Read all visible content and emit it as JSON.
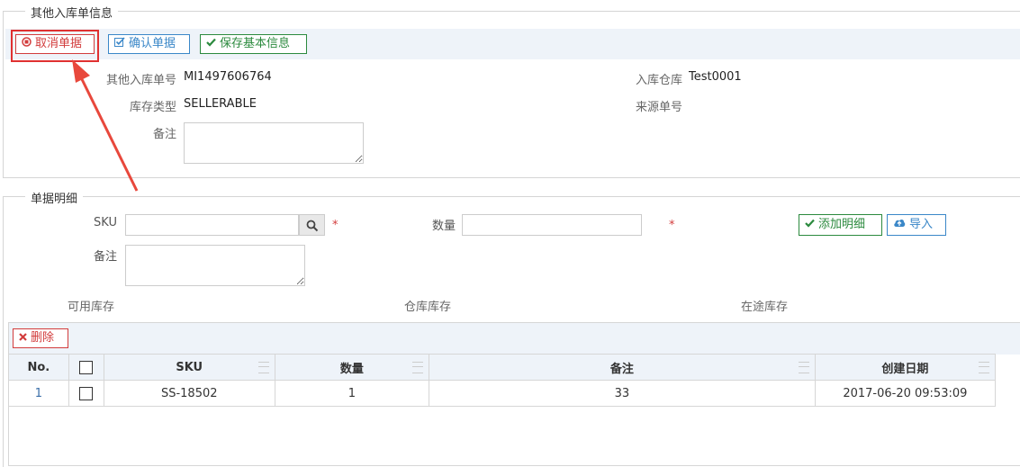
{
  "section1": {
    "title": "其他入库单信息",
    "buttons": {
      "cancel": "取消单据",
      "confirm": "确认单据",
      "save": "保存基本信息"
    },
    "fields": {
      "order_no_label": "其他入库单号",
      "order_no_value": "MI1497606764",
      "warehouse_label": "入库仓库",
      "warehouse_value": "Test0001",
      "stock_type_label": "库存类型",
      "stock_type_value": "SELLERABLE",
      "source_no_label": "来源单号",
      "remark_label": "备注"
    }
  },
  "section2": {
    "title": "单据明细",
    "sku_label": "SKU",
    "qty_label": "数量",
    "remark_label": "备注",
    "required_mark": "*",
    "add_detail_button": "添加明细",
    "import_button": "导入",
    "available_stock_label": "可用库存",
    "warehouse_stock_label": "仓库库存",
    "in_transit_stock_label": "在途库存",
    "delete_button": "删除"
  },
  "table": {
    "columns": [
      "No.",
      "SKU",
      "数量",
      "备注",
      "创建日期"
    ],
    "rows": [
      {
        "no": "1",
        "sku": "SS-18502",
        "qty": "1",
        "remark": "33",
        "created": "2017-06-20 09:53:09"
      }
    ]
  },
  "colors": {
    "accent_red": "#d23c3c",
    "accent_blue": "#3a87c8",
    "accent_green": "#2b8a3e",
    "toolbar_bg": "#eef3f9"
  },
  "icons": {
    "cancel": "circle-stop-icon",
    "confirm": "check-square-icon",
    "save": "check-icon",
    "search": "search-icon",
    "add": "check-icon",
    "import": "cloud-upload-icon",
    "delete": "close-icon"
  }
}
